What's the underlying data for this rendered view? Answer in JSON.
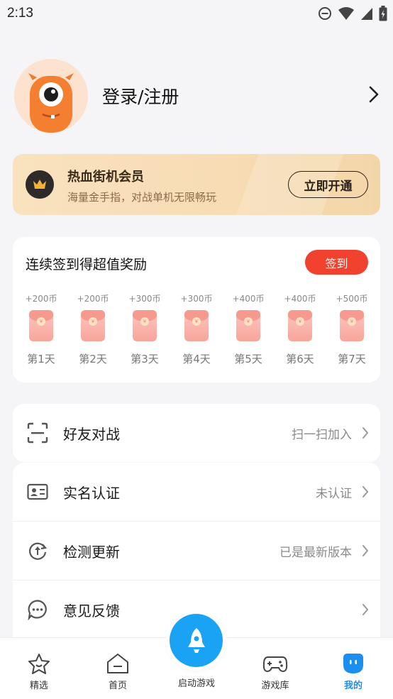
{
  "status_bar": {
    "time": "2:13"
  },
  "profile": {
    "login_label": "登录/注册"
  },
  "vip": {
    "title": "热血街机会员",
    "subtitle": "海量金手指，对战单机无限畅玩",
    "button": "立即开通"
  },
  "signin": {
    "title": "连续签到得超值奖励",
    "button": "签到",
    "days": [
      {
        "coins": "+200币",
        "label": "第1天"
      },
      {
        "coins": "+200币",
        "label": "第2天"
      },
      {
        "coins": "+300币",
        "label": "第3天"
      },
      {
        "coins": "+300币",
        "label": "第4天"
      },
      {
        "coins": "+400币",
        "label": "第5天"
      },
      {
        "coins": "+400币",
        "label": "第6天"
      },
      {
        "coins": "+500币",
        "label": "第7天"
      }
    ]
  },
  "menu": {
    "friend_battle": {
      "label": "好友对战",
      "value": "扫一扫加入"
    },
    "real_name": {
      "label": "实名认证",
      "value": "未认证"
    },
    "update": {
      "label": "检测更新",
      "value": "已是最新版本"
    },
    "feedback": {
      "label": "意见反馈",
      "value": ""
    }
  },
  "tabbar": {
    "featured": "精选",
    "home": "首页",
    "launch": "启动游戏",
    "library": "游戏库",
    "mine": "我的",
    "active_color": "#1b8ff0"
  }
}
